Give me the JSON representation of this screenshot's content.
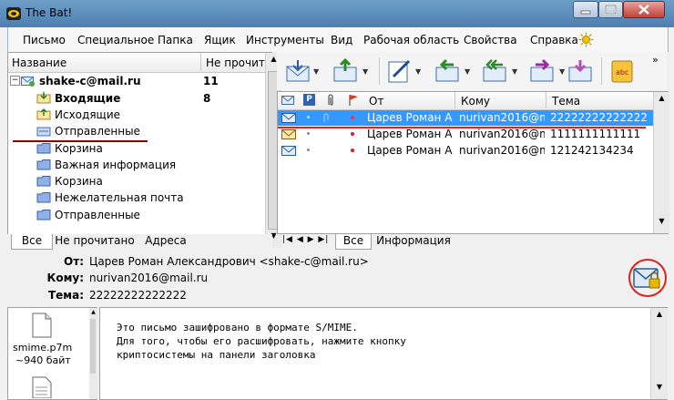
{
  "window": {
    "title": "The Bat!",
    "close_color": "#c0413a"
  },
  "menu": {
    "items": [
      "Письмо",
      "Специальное",
      "Папка",
      "Ящик",
      "Инструменты",
      "Вид",
      "Рабочая область",
      "Свойства",
      "Справка"
    ]
  },
  "folders": {
    "col_name": "Название",
    "col_unread": "Не прочит",
    "account": {
      "label": "shake-c@mail.ru",
      "unread": "11"
    },
    "items": [
      {
        "label": "Входящие",
        "unread": "8",
        "bold": true,
        "icon": "inbox-icon"
      },
      {
        "label": "Исходящие",
        "unread": "",
        "bold": false,
        "icon": "outbox-icon"
      },
      {
        "label": "Отправленные",
        "unread": "",
        "bold": false,
        "icon": "sent-folder-icon"
      },
      {
        "label": "Корзина",
        "unread": "",
        "bold": false,
        "icon": "folder-icon"
      },
      {
        "label": "Важная информация",
        "unread": "",
        "bold": false,
        "icon": "folder-icon"
      },
      {
        "label": "Корзина",
        "unread": "",
        "bold": false,
        "icon": "folder-icon"
      },
      {
        "label": "Нежелательная почта",
        "unread": "",
        "bold": false,
        "icon": "folder-icon"
      },
      {
        "label": "Отправленные",
        "unread": "",
        "bold": false,
        "icon": "folder-icon"
      }
    ],
    "tabs": [
      "Все",
      "Не прочитано",
      "Адреса"
    ]
  },
  "message_list": {
    "columns": {
      "from": "От",
      "to": "Кому",
      "subject": "Тема"
    },
    "rows": [
      {
        "from": "Царев Роман А...",
        "to": "nurivan2016@m...",
        "subject": "22222222222222",
        "selected": true
      },
      {
        "from": "Царев Роман А...",
        "to": "nurivan2016@m...",
        "subject": "1111111111111",
        "selected": false
      },
      {
        "from": "Царев Роман А...",
        "to": "nurivan2016@m...",
        "subject": "121242134234",
        "selected": false
      }
    ],
    "tabs": [
      "Все",
      "Информация"
    ],
    "selection_color": "#3399ff"
  },
  "message_header": {
    "from_label": "От:",
    "from_value": "Царев Роман Александрович <shake-c@mail.ru>",
    "to_label": "Кому:",
    "to_value": "nurivan2016@mail.ru",
    "subject_label": "Тема:",
    "subject_value": "22222222222222"
  },
  "attachment": {
    "name": "smime.p7m",
    "size": "~940 байт"
  },
  "body": {
    "lines": [
      "Это письмо зашифровано в формате S/MIME.",
      "Для того, чтобы его расшифровать, нажмите кнопку",
      "криптосистемы на панели заголовка"
    ]
  },
  "annotation_color": "#e02020"
}
